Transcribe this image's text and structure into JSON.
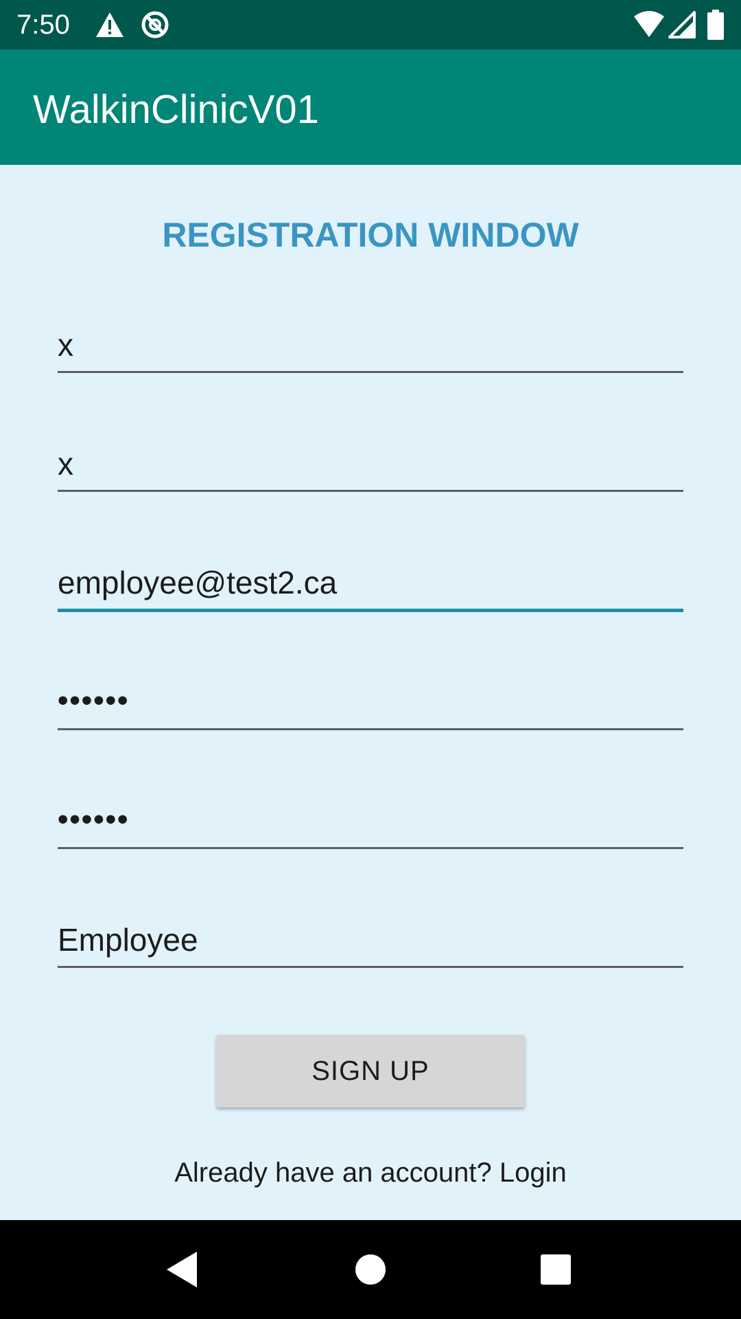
{
  "status_bar": {
    "time": "7:50",
    "icons_left": [
      "warning-icon",
      "no-sync-icon"
    ],
    "icons_right": [
      "wifi-icon",
      "cell-signal-icon",
      "battery-icon"
    ]
  },
  "app_bar": {
    "title": "WalkinClinicV01"
  },
  "form": {
    "heading": "REGISTRATION WINDOW",
    "first_name": {
      "value": "x"
    },
    "last_name": {
      "value": "x"
    },
    "email": {
      "value": "employee@test2.ca"
    },
    "password": {
      "value": "••••••"
    },
    "confirm_password": {
      "value": "••••••"
    },
    "role": {
      "value": "Employee"
    },
    "signup_label": "SIGN UP",
    "login_link": "Already have an account? Login"
  },
  "nav_bar": {
    "buttons": [
      "back-icon",
      "home-icon",
      "recents-icon"
    ]
  },
  "colors": {
    "status_bar": "#00574b",
    "app_bar": "#008577",
    "background": "#e2f2fb",
    "heading": "#3b95c2",
    "focus_underline": "#1b8ea6",
    "button": "#d6d6d6"
  }
}
